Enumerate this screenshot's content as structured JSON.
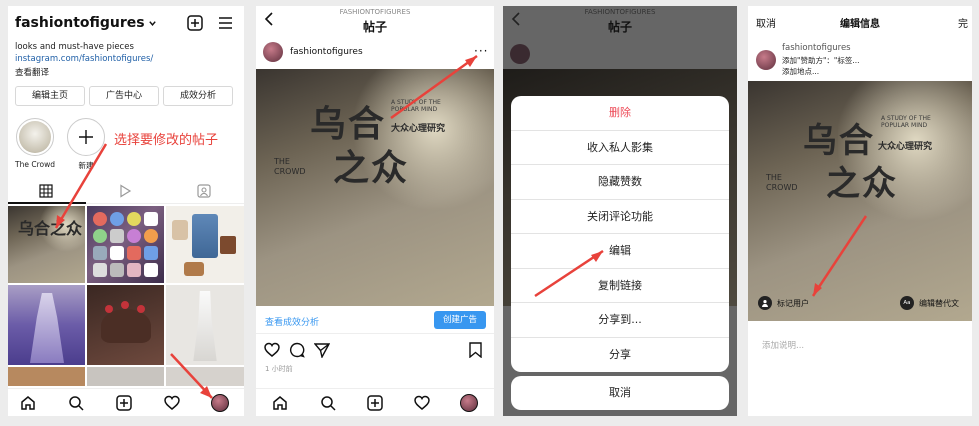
{
  "profile": {
    "username": "fashiontofigures",
    "bio": "looks and must-have pieces",
    "link": "instagram.com/fashiontofigures/",
    "translate": "查看翻译",
    "buttons": [
      "编辑主页",
      "广告中心",
      "成效分析"
    ],
    "highlights": [
      {
        "label": "The Crowd"
      },
      {
        "label": "新建"
      }
    ],
    "annotation": "选择要修改的帖子"
  },
  "post": {
    "header_small": "FASHIONTOFIGURES",
    "title": "帖子",
    "username": "fashiontofigures",
    "cover_title": "乌合之众",
    "cover_cn_sub": "大众心理研究",
    "cover_en": "A STUDY OF THE POPULAR MIND",
    "cover_crowd": "THE CROWD",
    "insights": "查看成效分析",
    "promote": "创建广告",
    "time": "1 小时前"
  },
  "sheet": {
    "header_small": "FASHIONTOFIGURES",
    "title": "帖子",
    "items": [
      "删除",
      "收入私人影集",
      "隐藏赞数",
      "关闭评论功能",
      "编辑",
      "复制链接",
      "分享到...",
      "分享"
    ],
    "cancel": "取消"
  },
  "edit": {
    "cancel": "取消",
    "title": "编辑信息",
    "done": "完",
    "username": "fashiontofigures",
    "sponsor": "添加\"赞助方\"：\"标签...",
    "location": "添加地点...",
    "tag_people": "标记用户",
    "alt_text": "编辑替代文",
    "caption_placeholder": "添加说明..."
  },
  "colors": {
    "accent": "#3897f0",
    "destructive": "#ed4956",
    "annotation": "#e8423b"
  }
}
